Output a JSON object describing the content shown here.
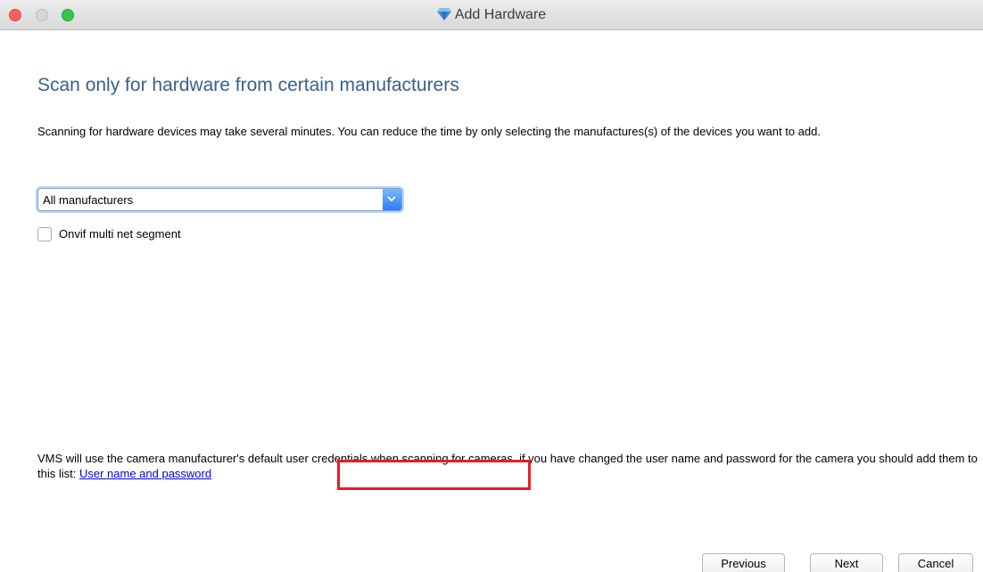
{
  "window": {
    "title": "Add Hardware",
    "icon": "diamond-icon"
  },
  "page": {
    "heading": "Scan only for hardware from certain manufacturers",
    "description": "Scanning for hardware devices may take several minutes. You can reduce the time by only selecting the manufactures(s) of the devices you want to add."
  },
  "manufacturer_select": {
    "value": "All manufacturers"
  },
  "onvif_checkbox": {
    "label": "Onvif multi net segment",
    "checked": false
  },
  "credentials": {
    "text": "VMS will use the camera manufacturer's default user credentials when scanning for cameras. if you have changed the user name and password for the camera you should add them to this list: ",
    "link": "User name and password"
  },
  "buttons": {
    "previous": "Previous",
    "next": "Next",
    "cancel": "Cancel"
  },
  "colors": {
    "heading": "#38618c",
    "link": "#0000ee",
    "highlight": "#ea1c24",
    "accent": "#2f7cf6"
  }
}
